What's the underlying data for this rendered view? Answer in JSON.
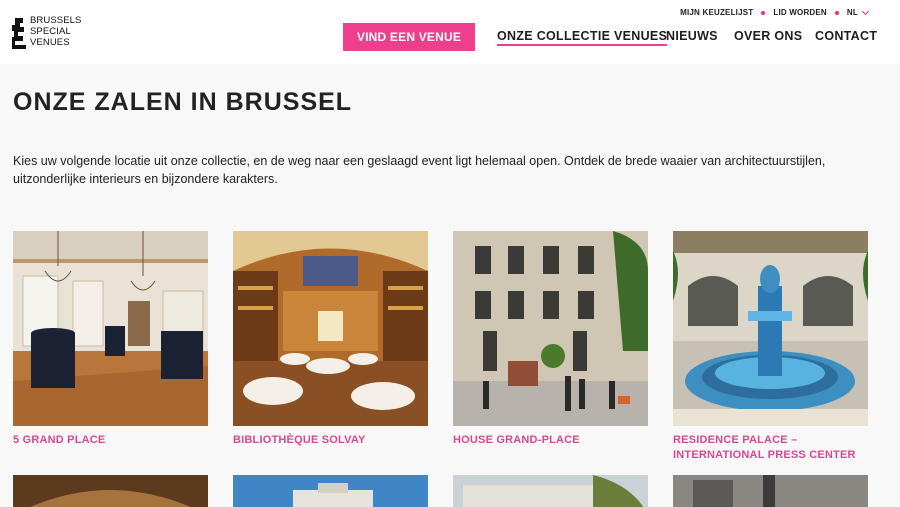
{
  "brand": {
    "logo_lines": [
      "BRUSSELS",
      "SPECIAL",
      "VENUES"
    ],
    "accent": "#ee3e8e"
  },
  "topnav": {
    "wishlist": "MIJN KEUZELIJST",
    "member": "LID WORDEN",
    "language": "NL"
  },
  "header": {
    "cta_label": "VIND EEN VENUE",
    "nav": [
      "ONZE COLLECTIE VENUES",
      "NIEUWS",
      "OVER ONS",
      "CONTACT"
    ],
    "active_nav": "ONZE COLLECTIE VENUES"
  },
  "main": {
    "title": "ONZE ZALEN IN BRUSSEL",
    "intro": "Kies uw volgende locatie uit onze collectie, en de weg naar een geslaagd event ligt helemaal open. Ontdek de brede waaier van architectuurstijlen, uitzonderlijke interieurs en bijzondere karakters.",
    "venues": [
      {
        "name": "5 GRAND PLACE"
      },
      {
        "name": "BIBLIOTHÈQUE SOLVAY"
      },
      {
        "name": "HOUSE GRAND-PLACE"
      },
      {
        "name": "RESIDENCE PALACE – INTERNATIONAL PRESS CENTER"
      }
    ]
  }
}
